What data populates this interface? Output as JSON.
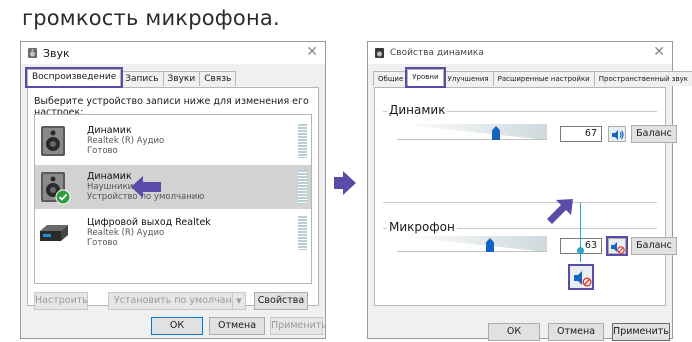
{
  "heading": "громкость микрофона.",
  "dialog1": {
    "title": "Звук",
    "tabs": [
      "Воспроизведение",
      "Запись",
      "Звуки",
      "Связь"
    ],
    "description": "Выберите устройство записи ниже для изменения его настроек:",
    "devices": [
      {
        "name": "Динамик",
        "driver": "Realtek (R) Аудио",
        "status": "Готово"
      },
      {
        "name": "Динамик",
        "driver": "Наушники",
        "status": "Устройство по умолчанию"
      },
      {
        "name": "Цифровой выход Realtek",
        "driver": "Realtek (R) Аудио",
        "status": "Готово"
      }
    ],
    "configure_label": "Настроить",
    "set_default_label": "Установить по умолчанию",
    "properties_label": "Свойства",
    "ok_label": "ОК",
    "cancel_label": "Отмена",
    "apply_label": "Применить"
  },
  "dialog2": {
    "title": "Свойства динамика",
    "tabs": [
      "Общие",
      "Уровни",
      "Улучшения",
      "Расширенные настройки",
      "Пространственный звук"
    ],
    "speaker": {
      "label": "Динамик",
      "value": "67",
      "level": 67,
      "balance_label": "Баланс"
    },
    "microphone": {
      "label": "Микрофон",
      "value": "63",
      "level": 63,
      "balance_label": "Баланс"
    },
    "ok_label": "ОК",
    "cancel_label": "Отмена",
    "apply_label": "Применить"
  },
  "colors": {
    "highlight": "#5a4ba8",
    "accent": "#1565c0",
    "connector": "#2ba8c8",
    "ok_green": "#2e9b3e",
    "mute_red": "#d9342b"
  },
  "icons": [
    "speaker-icon",
    "check-badge-icon",
    "digital-output-icon",
    "volume-icon",
    "muted-volume-icon",
    "pointer-arrow-icon",
    "close-icon"
  ]
}
